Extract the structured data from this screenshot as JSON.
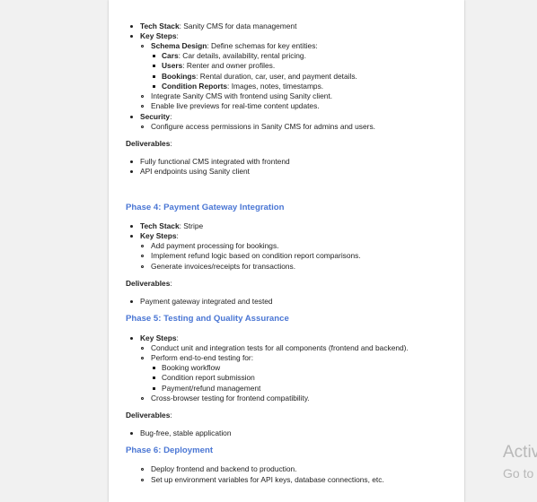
{
  "phase3": {
    "tech_stack_label": "Tech Stack",
    "tech_stack_value": ": Sanity CMS for data management",
    "key_steps_label": "Key Steps",
    "key_steps_colon": ":",
    "schema_design_label": "Schema Design",
    "schema_design_value": ": Define schemas for key entities:",
    "cars_label": "Cars",
    "cars_value": ": Car details, availability, rental pricing.",
    "users_label": "Users",
    "users_value": ": Renter and owner profiles.",
    "bookings_label": "Bookings",
    "bookings_value": ": Rental duration, car, user, and payment details.",
    "condition_reports_label": "Condition Reports",
    "condition_reports_value": ": Images, notes, timestamps.",
    "integrate_step": "Integrate Sanity CMS with frontend using Sanity client.",
    "previews_step": "Enable live previews for real-time content updates.",
    "security_label": "Security",
    "security_colon": ":",
    "security_step": "Configure access permissions in Sanity CMS for admins and users.",
    "deliverables_label": "Deliverables",
    "deliverables_colon": ":",
    "deliverables": [
      "Fully functional CMS integrated with frontend",
      "API endpoints using Sanity client"
    ]
  },
  "phase4": {
    "heading": "Phase 4: Payment Gateway Integration",
    "tech_stack_label": "Tech Stack",
    "tech_stack_value": ": Stripe",
    "key_steps_label": "Key Steps",
    "key_steps_colon": ":",
    "steps": [
      "Add payment processing for bookings.",
      "Implement refund logic based on condition report comparisons.",
      "Generate invoices/receipts for transactions."
    ],
    "deliverables_label": "Deliverables",
    "deliverables_colon": ":",
    "deliverables": [
      "Payment gateway integrated and tested"
    ]
  },
  "phase5": {
    "heading": "Phase 5: Testing and Quality Assurance",
    "key_steps_label": "Key Steps",
    "key_steps_colon": ":",
    "step_unit": "Conduct unit and integration tests for all components (frontend and backend).",
    "step_e2e": "Perform end-to-end testing for:",
    "e2e_items": [
      "Booking workflow",
      "Condition report submission",
      "Payment/refund management"
    ],
    "step_browser": "Cross-browser testing for frontend compatibility.",
    "deliverables_label": "Deliverables",
    "deliverables_colon": ":",
    "deliverables": [
      "Bug-free, stable application"
    ]
  },
  "phase6": {
    "heading": "Phase 6: Deployment",
    "steps": [
      "Deploy frontend and backend to production.",
      "Set up environment variables for API keys, database connections, etc."
    ]
  },
  "watermark": {
    "line1": "Activ",
    "line2": "Go to"
  },
  "colors": {
    "heading": "#4a76d4",
    "page_bg": "#ffffff",
    "desktop_bg": "#f1f1f1"
  }
}
